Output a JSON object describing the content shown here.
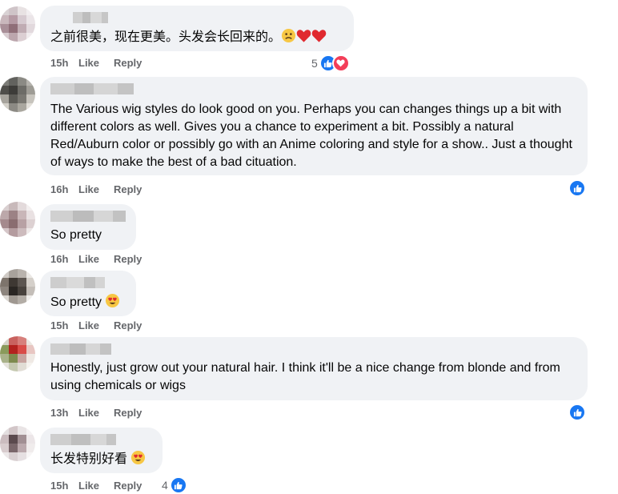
{
  "comments": [
    {
      "text": "之前很美，现在更美。头发会长回来的。",
      "emojis": [
        "sad-face",
        "red-heart",
        "red-heart"
      ],
      "time": "15h",
      "like": "Like",
      "reply": "Reply",
      "reaction_count": "5",
      "reactions": [
        "like",
        "love"
      ]
    },
    {
      "text": "The Various wig styles do look good on you. Perhaps you can changes things up a bit with different colors as well. Gives you a chance to experiment a bit. Possibly a natural Red/Auburn color or possibly go with an Anime coloring and style for a show.. Just a thought of ways to make the best of a bad cituation.",
      "time": "16h",
      "like": "Like",
      "reply": "Reply",
      "reactions": [
        "like"
      ]
    },
    {
      "text": "So pretty",
      "time": "16h",
      "like": "Like",
      "reply": "Reply"
    },
    {
      "text": "So pretty",
      "emojis": [
        "heart-eyes"
      ],
      "time": "15h",
      "like": "Like",
      "reply": "Reply"
    },
    {
      "text": "Honestly, just grow out your natural hair. I think it'll be a nice change from blonde and from using chemicals or wigs",
      "time": "13h",
      "like": "Like",
      "reply": "Reply",
      "reactions": [
        "like"
      ]
    },
    {
      "text": "长发特别好看",
      "emojis": [
        "heart-eyes"
      ],
      "time": "15h",
      "like": "Like",
      "reply": "Reply",
      "reaction_count": "4",
      "reactions": [
        "like"
      ]
    }
  ],
  "colors": {
    "bubble": "#f0f2f5",
    "meta_text": "#65676b",
    "like_blue": "#1877f2",
    "love_red": "#f33e58"
  }
}
